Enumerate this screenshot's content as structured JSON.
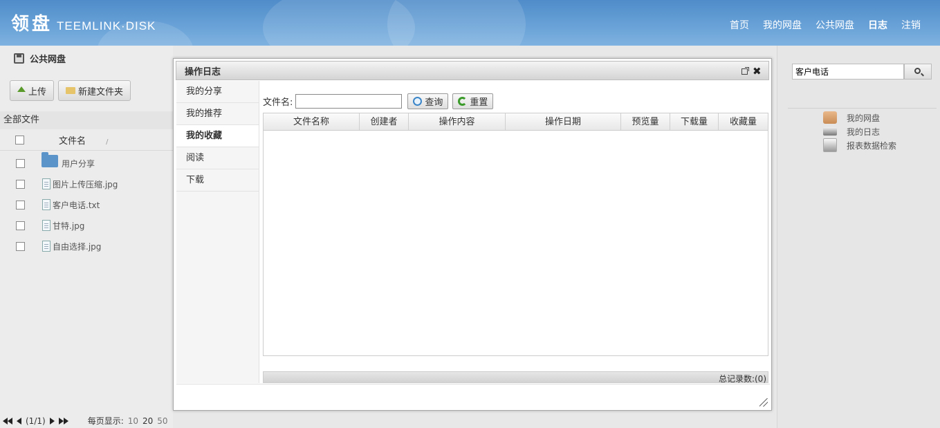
{
  "header": {
    "logo_cn": "领盘",
    "logo_en": "TEEMLINK·DISK",
    "nav": [
      {
        "label": "首页"
      },
      {
        "label": "我的网盘"
      },
      {
        "label": "公共网盘"
      },
      {
        "label": "日志"
      },
      {
        "label": "注销"
      }
    ]
  },
  "left": {
    "title": "公共网盘",
    "upload_label": "上传",
    "new_folder_label": "新建文件夹",
    "all_files": "全部文件",
    "column_filename": "文件名",
    "sort_indicator": "/",
    "files": [
      {
        "name": "用户分享",
        "type": "folder"
      },
      {
        "name": "图片上传压缩.jpg",
        "type": "file"
      },
      {
        "name": "客户电话.txt",
        "type": "file"
      },
      {
        "name": "甘特.jpg",
        "type": "file"
      },
      {
        "name": "自由选择.jpg",
        "type": "file"
      }
    ]
  },
  "pager": {
    "page_info": "(1/1)",
    "per_page_label": "每页显示:",
    "sizes": [
      "10",
      "20",
      "50"
    ]
  },
  "right": {
    "search_value": "客户电话",
    "links": [
      {
        "label": "我的网盘",
        "icon": "disk-icon"
      },
      {
        "label": "我的日志",
        "icon": "log-icon"
      },
      {
        "label": "报表数据检索",
        "icon": "report-icon"
      }
    ]
  },
  "dialog": {
    "title": "操作日志",
    "side_items": [
      "我的分享",
      "我的推荐",
      "我的收藏",
      "阅读",
      "下载"
    ],
    "active_item": "我的收藏",
    "filename_label": "文件名:",
    "query_label": "查询",
    "reset_label": "重置",
    "columns": [
      "文件名称",
      "创建者",
      "操作内容",
      "操作日期",
      "预览量",
      "下载量",
      "收藏量"
    ],
    "total_label": "总记录数:(0)"
  }
}
